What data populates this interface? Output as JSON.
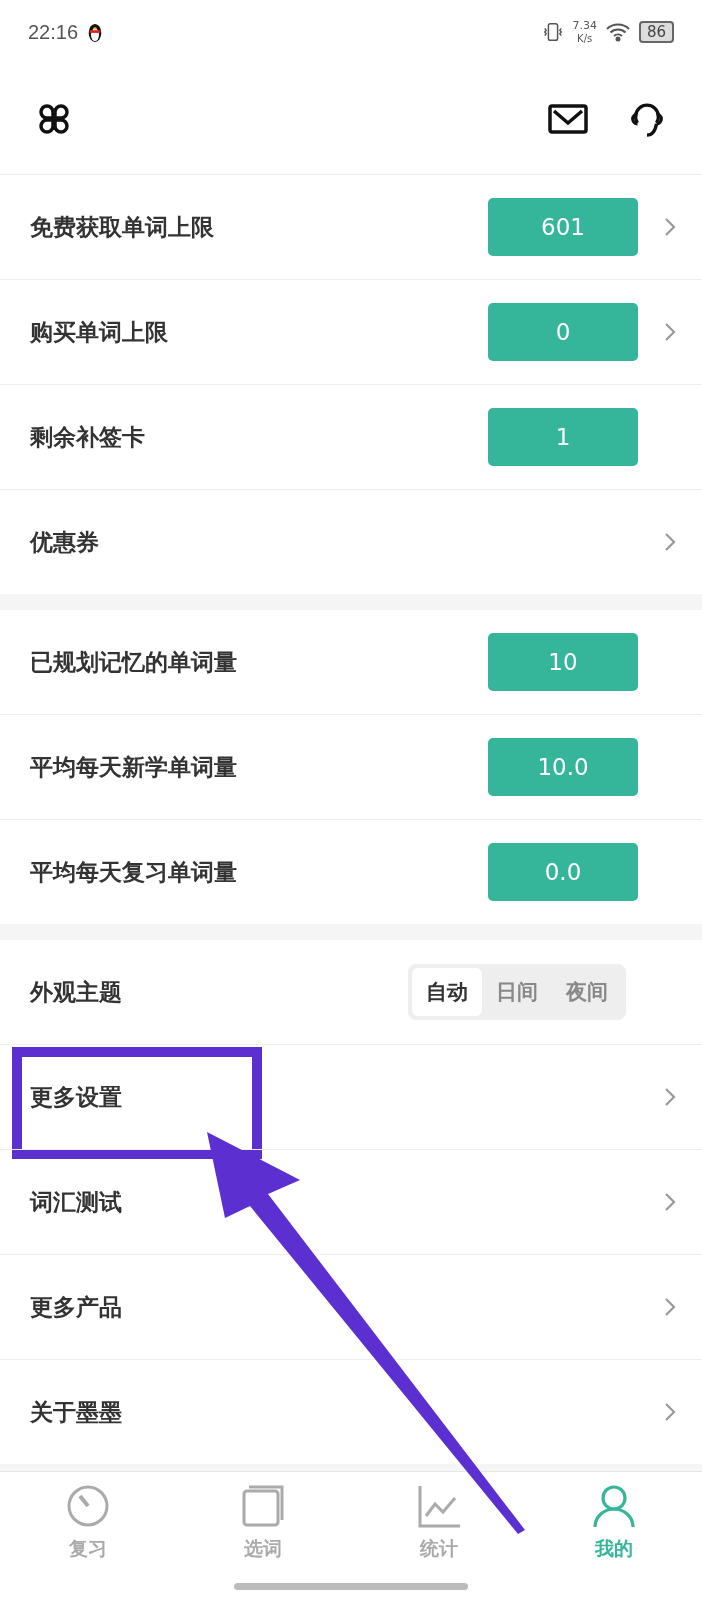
{
  "status_bar": {
    "time": "22:16",
    "speed": "7.34",
    "speed_unit": "K/s",
    "battery": "86"
  },
  "sections": [
    {
      "rows": [
        {
          "label": "免费获取单词上限",
          "value": "601",
          "chevron": true
        },
        {
          "label": "购买单词上限",
          "value": "0",
          "chevron": true
        },
        {
          "label": "剩余补签卡",
          "value": "1",
          "chevron": false
        },
        {
          "label": "优惠券",
          "chevron": true
        }
      ]
    },
    {
      "rows": [
        {
          "label": "已规划记忆的单词量",
          "value": "10",
          "chevron": false
        },
        {
          "label": "平均每天新学单词量",
          "value": "10.0",
          "chevron": false
        },
        {
          "label": "平均每天复习单词量",
          "value": "0.0",
          "chevron": false
        }
      ]
    },
    {
      "rows": [
        {
          "label": "外观主题",
          "options": [
            {
              "label": "自动",
              "selected": true
            },
            {
              "label": "日间",
              "selected": false
            },
            {
              "label": "夜间",
              "selected": false
            }
          ]
        },
        {
          "label": "更多设置",
          "chevron": true,
          "highlighted": true
        },
        {
          "label": "词汇测试",
          "chevron": true
        },
        {
          "label": "更多产品",
          "chevron": true
        },
        {
          "label": "关于墨墨",
          "chevron": true
        }
      ]
    }
  ],
  "tab_bar": [
    {
      "label": "复习",
      "kind": "review",
      "selected": false
    },
    {
      "label": "选词",
      "kind": "words",
      "selected": false
    },
    {
      "label": "统计",
      "kind": "stats",
      "selected": false
    },
    {
      "label": "我的",
      "kind": "me",
      "selected": true
    }
  ]
}
